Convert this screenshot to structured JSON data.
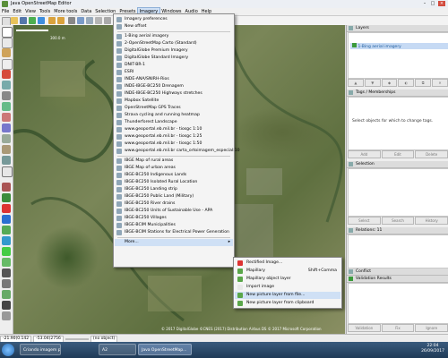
{
  "window": {
    "title": "Java OpenStreetMap Editor",
    "minimize": "–",
    "maximize": "□",
    "close": "×"
  },
  "menubar": [
    "File",
    "Edit",
    "View",
    "Tools",
    "More tools",
    "Data",
    "Selection",
    "Presets",
    "Imagery",
    "Windows",
    "Audio",
    "Help"
  ],
  "imagery_menu": {
    "items": [
      {
        "label": "Imagery preferences",
        "icon": "preferences-icon"
      },
      {
        "label": "New offset",
        "icon": "offset-icon"
      },
      {
        "sep": true
      },
      {
        "label": "1-Bing aerial imagery",
        "icon": "bing-icon"
      },
      {
        "label": "2-OpenStreetMap Carto (Standard)",
        "icon": "osm-icon"
      },
      {
        "label": "DigitalGlobe Premium Imagery",
        "icon": "digitalglobe-icon"
      },
      {
        "label": "DigitalGlobe Standard Imagery",
        "icon": "digitalglobe-icon"
      },
      {
        "label": "DNIT-BR-1",
        "icon": "imagery-icon"
      },
      {
        "label": "ESRI",
        "icon": "esri-icon"
      },
      {
        "label": "INDE-ANA/SNIRH-Rios",
        "icon": "imagery-icon"
      },
      {
        "label": "INDE-IBGE-BC250 Drenagem",
        "icon": "imagery-icon"
      },
      {
        "label": "INDE-IBGE-BC250 Highways stretches",
        "icon": "imagery-icon"
      },
      {
        "label": "Mapbox Satellite",
        "icon": "mapbox-icon"
      },
      {
        "label": "OpenStreetMap GPS Traces",
        "icon": "gps-icon"
      },
      {
        "label": "Strava cycling and running heatmap",
        "icon": "strava-icon"
      },
      {
        "label": "Thunderforest Landscape",
        "icon": "thunderforest-icon"
      },
      {
        "label": "www.geoportal.eb.mil.br - tiosgc 1:10",
        "icon": "imagery-icon"
      },
      {
        "label": "www.geoportal.eb.mil.br - tiosgc 1:25",
        "icon": "imagery-icon"
      },
      {
        "label": "www.geoportal.eb.mil.br - tiosgc 1:50",
        "icon": "imagery-icon"
      },
      {
        "label": "www.geoportal.eb.mil.br carta_ortoimagem_especial:10",
        "icon": "imagery-icon"
      },
      {
        "sep": true
      },
      {
        "label": "IBGE Map of rural areas",
        "icon": "imagery-icon"
      },
      {
        "label": "IBGE Map of urban areas",
        "icon": "imagery-icon"
      },
      {
        "label": "IBGE-BC250 Indigenous Lands",
        "icon": "imagery-icon"
      },
      {
        "label": "IBGE-BC250 Isolated Rural Location",
        "icon": "imagery-icon"
      },
      {
        "label": "IBGE-BC250 Landing strip",
        "icon": "imagery-icon"
      },
      {
        "label": "IBGE-BC250 Public Land (Military)",
        "icon": "imagery-icon"
      },
      {
        "label": "IBGE-BC250 River drains",
        "icon": "imagery-icon"
      },
      {
        "label": "IBGE-BC250 Units of Sustainable Use - APA",
        "icon": "imagery-icon"
      },
      {
        "label": "IBGE-BC250 Villages",
        "icon": "imagery-icon"
      },
      {
        "label": "IBGE-BCIM Municipalities",
        "icon": "imagery-icon"
      },
      {
        "label": "IBGE-BCIM Stations for Electrical Power Generation",
        "icon": "imagery-icon"
      },
      {
        "sep": true
      },
      {
        "label": "More...",
        "icon": "",
        "submenu": true,
        "highlighted": true
      }
    ]
  },
  "submenu": {
    "items": [
      {
        "label": "Rectified Image...",
        "shortcut": "",
        "icon": "rectified-icon"
      },
      {
        "label": "Mapillary",
        "shortcut": "Shift+Comma",
        "icon": "mapillary-icon"
      },
      {
        "label": "Mapillary object layer",
        "shortcut": "",
        "icon": "mapillary-icon"
      },
      {
        "label": "Import image",
        "shortcut": "",
        "icon": "image-icon"
      },
      {
        "label": "New picture layer from file...",
        "shortcut": "",
        "icon": "picture-icon",
        "highlighted": true
      },
      {
        "label": "New picture layer from clipboard",
        "shortcut": "",
        "icon": "picture-icon"
      }
    ]
  },
  "map": {
    "scale_label": "300.0 m",
    "attribution": "© 2017 DigitalGlobe ©CNES (2017) Distribution Airbus DS © 2017 Microsoft Corporation"
  },
  "panels": {
    "layers": {
      "title": "Layers",
      "selected_layer": "1-Bing aerial imagery"
    },
    "tags": {
      "title": "Tags / Memberships",
      "hint": "Select objects for which to change tags.",
      "buttons": [
        "Add",
        "Edit",
        "Delete"
      ]
    },
    "selection": {
      "title": "Selection",
      "buttons": [
        "Select",
        "Search",
        "History"
      ]
    },
    "relations": {
      "title": "Relations: 11"
    },
    "conflict": {
      "title": "Conflict"
    },
    "validation": {
      "title": "Validation Results",
      "buttons": [
        "Validation",
        "Fix",
        "Ignore"
      ]
    }
  },
  "statusbar": {
    "lat": "-21.90(0.142",
    "lon": "-53.04(2756",
    "heading": "",
    "mode": "(no object)"
  },
  "taskbar": {
    "items": [
      "Criando imagem pa...",
      "A2",
      "Java OpenStreetMap..."
    ],
    "time": "22:04",
    "date": "26/09/2017"
  },
  "colors": {
    "menu_highlight": "#cfe0f5",
    "layer_selected": "#c6daf4",
    "taskbar": "#2b4a6b"
  }
}
